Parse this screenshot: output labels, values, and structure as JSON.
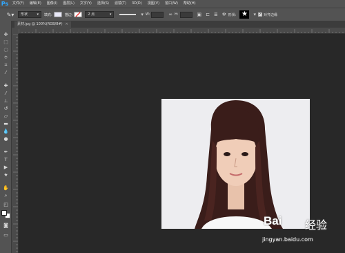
{
  "app": {
    "logo": "Ps"
  },
  "menu": [
    "文件(F)",
    "编辑(E)",
    "图像(I)",
    "图层(L)",
    "文字(Y)",
    "选择(S)",
    "滤镜(T)",
    "3D(D)",
    "视图(V)",
    "窗口(W)",
    "帮助(H)"
  ],
  "options": {
    "mode": "形状",
    "fill_label": "填充:",
    "stroke_label": "描边:",
    "stroke_size": "2 点",
    "w_label": "W:",
    "h_label": "H:",
    "shape_label": "形状:",
    "align_edges_label": "对齐边缘"
  },
  "document": {
    "tab_title": "素材.jpg @ 100%(RGB/8#)",
    "close": "×"
  },
  "watermark": {
    "logo": "Bai",
    "text": "经验",
    "url": "jingyan.baidu.com"
  },
  "colors": {
    "menubar": "#535353",
    "canvas": "#282828",
    "image_bg": "#ededf0"
  },
  "icons": {
    "tool_preset": "pen-icon",
    "shape": "star-icon"
  }
}
